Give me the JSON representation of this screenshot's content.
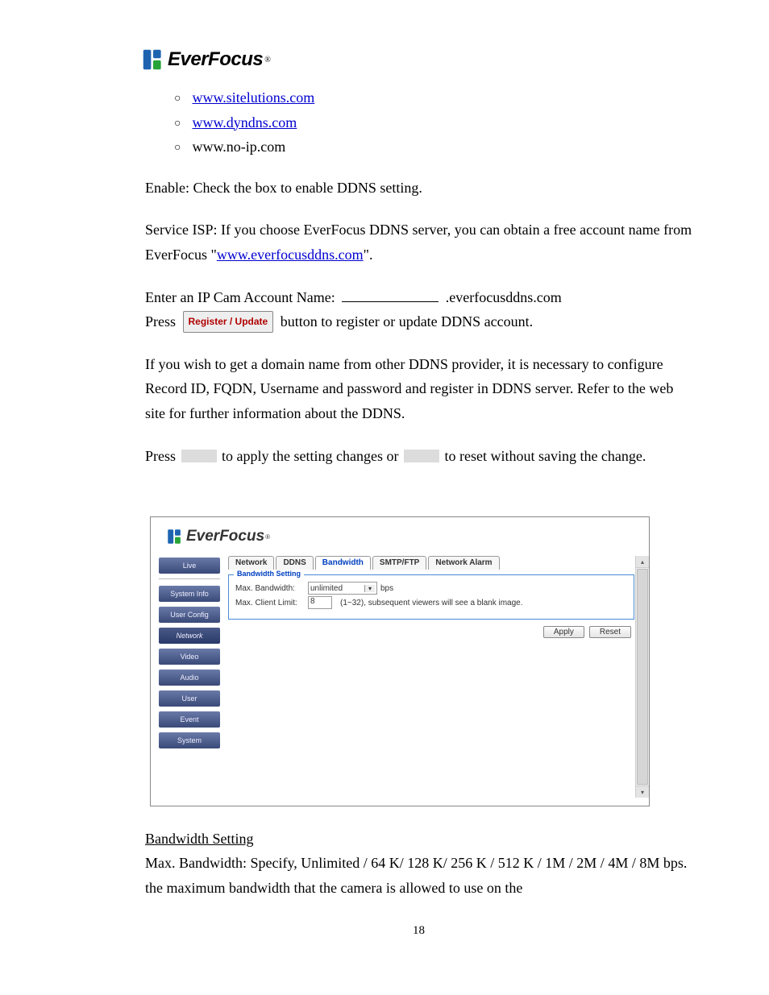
{
  "logo_text": "EverFocus",
  "links": {
    "sitelutions": "www.sitelutions.com",
    "dyndns": "www.dyndns.com",
    "noip": "www.no-ip.com",
    "everfocusddns": "www.everfocusddns.com"
  },
  "text": {
    "enable": "Enable: Check the box to enable DDNS setting.",
    "isp_a": "Service ISP: If you choose EverFocus DDNS server, you can obtain a free account name from EverFocus \"",
    "isp_b": "\".",
    "acct_label": "Enter an IP Cam Account Name:",
    "acct_domain": ".everfocusddns.com",
    "press": "Press",
    "reg_btn": "Register / Update",
    "reg_tail": "button to register or update DDNS account.",
    "other_provider": "If you wish to get a domain name from other DDNS provider, it is necessary to configure Record ID, FQDN, Username and password and register in DDNS server. Refer to the web site for further information about the DDNS.",
    "apply_a": "Press",
    "apply_b": "to apply the setting changes or",
    "apply_c": "to reset without saving the change."
  },
  "screenshot": {
    "logo": "EverFocus",
    "side": [
      "Live",
      "System Info",
      "User Config",
      "Network",
      "Video",
      "Audio",
      "User",
      "Event",
      "System"
    ],
    "side_selected": 3,
    "tabs": [
      "Network",
      "DDNS",
      "Bandwidth",
      "SMTP/FTP",
      "Network Alarm"
    ],
    "tab_selected": 2,
    "legend": "Bandwidth Setting",
    "row1_label": "Max. Bandwidth:",
    "row1_value": "unlimited",
    "row1_unit": "bps",
    "row2_label": "Max. Client Limit:",
    "row2_value": "8",
    "row2_hint": "(1~32), subsequent viewers will see a blank image.",
    "apply": "Apply",
    "reset": "Reset"
  },
  "bandwidth": {
    "heading": "Bandwidth Setting",
    "body": "Max. Bandwidth: Specify, Unlimited / 64 K/ 128 K/ 256 K / 512 K / 1M / 2M / 4M / 8M bps. the maximum bandwidth that the camera is allowed to use on the"
  },
  "page_number": "18"
}
